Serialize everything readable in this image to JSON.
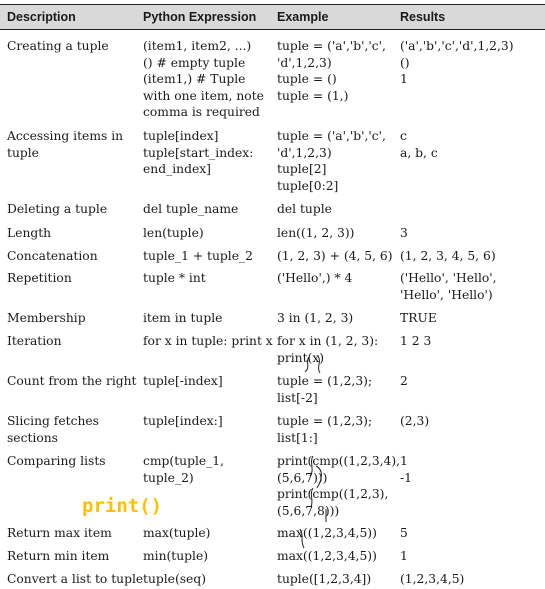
{
  "header": {
    "col1": "Description",
    "col2": "Python Expression",
    "col3": "Example",
    "col4": "Results"
  },
  "rows": [
    {
      "description": [
        "Creating a tuple"
      ],
      "expression": [
        "(item1, item2, ...)",
        "() # empty tuple",
        "(item1,) # Tuple",
        "with one item, note",
        "comma is required"
      ],
      "example": [
        "tuple = ('a','b','c',",
        "'d',1,2,3)",
        "tuple = ()",
        "tuple = (1,)"
      ],
      "result": [
        "('a','b','c','d',1,2,3)",
        "()",
        "1"
      ]
    },
    {
      "description": [
        "Accessing items in",
        "tuple"
      ],
      "expression": [
        "tuple[index]",
        "tuple[start_index:",
        "end_index]"
      ],
      "example": [
        "tuple = ('a','b','c',",
        "'d',1,2,3)",
        "tuple[2]",
        "tuple[0:2]"
      ],
      "result": [
        "c",
        "a, b, c"
      ]
    },
    {
      "description": [
        "Deleting a tuple"
      ],
      "expression": [
        "del tuple_name"
      ],
      "example": [
        "del tuple"
      ],
      "result": []
    },
    {
      "description": [
        "Length"
      ],
      "expression": [
        "len(tuple)"
      ],
      "example": [
        "len((1, 2, 3))"
      ],
      "result": [
        "3"
      ]
    },
    {
      "description": [
        "Concatenation"
      ],
      "expression": [
        "tuple_1 + tuple_2"
      ],
      "example": [
        "(1, 2, 3) + (4, 5, 6)"
      ],
      "result": [
        "(1, 2, 3, 4, 5, 6)"
      ]
    },
    {
      "description": [
        "Repetition"
      ],
      "expression": [
        "tuple * int"
      ],
      "example": [
        "('Hello',) * 4"
      ],
      "result": [
        "('Hello', 'Hello',",
        "'Hello', 'Hello')"
      ]
    },
    {
      "description": [
        "Membership"
      ],
      "expression": [
        "item in tuple"
      ],
      "example": [
        "3 in (1, 2, 3)"
      ],
      "result": [
        "TRUE"
      ]
    },
    {
      "description": [
        "Iteration"
      ],
      "expression": [
        "for x in tuple: print x"
      ],
      "example": [
        "for x in (1, 2, 3):",
        "print(x)"
      ],
      "result": [
        "1 2 3"
      ]
    },
    {
      "description": [
        "Count from the right"
      ],
      "expression": [
        "tuple[-index]"
      ],
      "example": [
        "tuple = (1,2,3);",
        "list[-2]"
      ],
      "result": [
        "2"
      ]
    },
    {
      "description": [
        "Slicing fetches",
        "sections"
      ],
      "expression": [
        "tuple[index:]"
      ],
      "example": [
        "tuple = (1,2,3);",
        "list[1:]"
      ],
      "result": [
        "(2,3)"
      ]
    },
    {
      "description": [
        "Comparing lists"
      ],
      "expression": [
        "cmp(tuple_1,",
        "tuple_2)"
      ],
      "example": [
        "print(cmp((1,2,3,4),",
        "(5,6,7)))",
        "print(cmp((1,2,3),",
        "(5,6,7,8)))"
      ],
      "result": [
        "1",
        "-1"
      ]
    },
    {
      "description": [
        "Return max item"
      ],
      "expression": [
        "max(tuple)"
      ],
      "example": [
        "max((1,2,3,4,5))"
      ],
      "result": [
        "5"
      ]
    },
    {
      "description": [
        "Return min item"
      ],
      "expression": [
        "min(tuple)"
      ],
      "example": [
        "max((1,2,3,4,5))"
      ],
      "result": [
        "1"
      ]
    },
    {
      "description": [
        "Convert a list to tuple"
      ],
      "expression": [
        "tuple(seq)"
      ],
      "example": [
        "tuple([1,2,3,4])"
      ],
      "result": [
        "(1,2,3,4,5)"
      ]
    }
  ],
  "annotation": {
    "text": "print()",
    "color": "#ffc000"
  }
}
